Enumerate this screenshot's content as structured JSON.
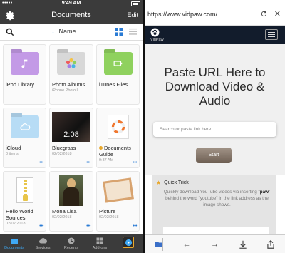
{
  "left_phone": {
    "status": {
      "carrier": "•••••",
      "time": "9:49 AM"
    },
    "nav": {
      "title": "Documents",
      "edit_label": "Edit"
    },
    "toolbar": {
      "sort_label": "Name"
    },
    "files": [
      {
        "name": "iPod Library",
        "sub": "",
        "kind": "folder",
        "color": "#c39ae6"
      },
      {
        "name": "Photo Albums",
        "sub": "iPhone Photo L...",
        "kind": "folder",
        "color": "#d8d8d8"
      },
      {
        "name": "iTunes Files",
        "sub": "",
        "kind": "folder",
        "color": "#8fd15e"
      },
      {
        "name": "iCloud",
        "sub": "0 items",
        "kind": "folder",
        "color": "#b7dcf5"
      },
      {
        "name": "Bluegrass",
        "sub": "02/02/2018",
        "kind": "video",
        "duration": "2:08"
      },
      {
        "name": "Documents Guide",
        "sub": "9:37 AM",
        "kind": "guide"
      },
      {
        "name": "Hello World Sources",
        "sub": "02/02/2018",
        "kind": "zip"
      },
      {
        "name": "Mona Lisa",
        "sub": "02/02/2018",
        "kind": "image"
      },
      {
        "name": "Picture",
        "sub": "02/02/2018",
        "kind": "picture"
      }
    ],
    "tabbar": [
      {
        "label": "Documents",
        "active": true
      },
      {
        "label": "Services",
        "active": false
      },
      {
        "label": "Recents",
        "active": false
      },
      {
        "label": "Add-ons",
        "active": false
      },
      {
        "label": "",
        "active": false
      }
    ]
  },
  "right_phone": {
    "url": "https://www.vidpaw.com/",
    "brand": "VidPaw",
    "hero_title": "Paste URL Here to Download Video & Audio",
    "search_placeholder": "Search or paste link here...",
    "start_label": "Start",
    "quick_trick_title": "Quick Trick",
    "quick_trick_text_before": "Quickly download YouTube videos via inserting \"",
    "quick_trick_keyword": "paw",
    "quick_trick_text_after": "\" behind the word \"youtube\" in the link address as the image shows."
  },
  "colors": {
    "dark_bar": "#3b3b3b",
    "accent_blue": "#2a7bd4",
    "header_navy": "#121c2c",
    "start_button": "#7d6e62"
  }
}
